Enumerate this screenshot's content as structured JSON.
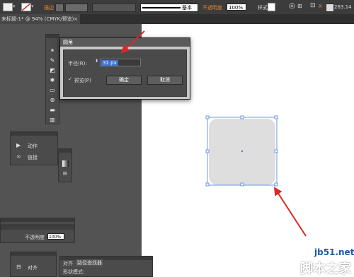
{
  "controlbar": {
    "stroke_label": "描边",
    "stroke_profile": "基本",
    "opacity_label": "不透明度",
    "opacity_value": "100%",
    "style_label": "样式",
    "width_value": "263.14"
  },
  "tab": {
    "title": "未标题-1* @ 94% (CMYK/预览)",
    "close": "×"
  },
  "dialog": {
    "title": "圆角",
    "radius_label": "半径(R):",
    "radius_value": "31 px",
    "preview_label": "预览(P)",
    "ok_label": "确定",
    "cancel_label": "取消"
  },
  "actions_panel": {
    "actions": "动作",
    "links": "链接"
  },
  "transparency_panel": {
    "label": "不透明度",
    "value": "100%"
  },
  "align_panel": {
    "align": "对齐"
  },
  "pathfinder_panel": {
    "tab_align": "对齐",
    "tab_pathfinder": "路径查找器",
    "shape_modes": "形状模式:"
  },
  "watermark": {
    "line1": "jb51.net",
    "line2": "脚本之家"
  },
  "colors": {
    "accent_red": "#d42a2a",
    "selection_blue": "#3a73c9",
    "shape_fill": "#dedede"
  }
}
